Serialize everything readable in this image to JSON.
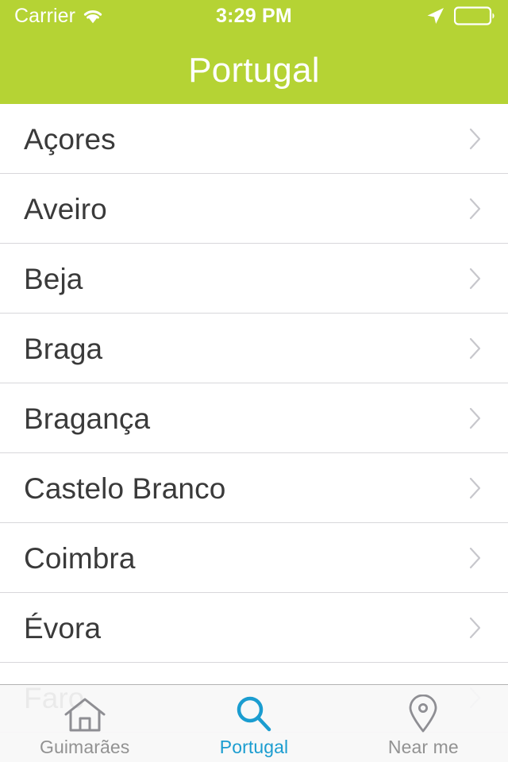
{
  "status_bar": {
    "carrier": "Carrier",
    "wifi_icon": "wifi-icon",
    "time": "3:29 PM",
    "location_icon": "location-arrow-icon",
    "battery_icon": "battery-icon"
  },
  "nav": {
    "title": "Portugal",
    "background_color": "#b5d334",
    "title_color": "#ffffff"
  },
  "list": {
    "rows": [
      {
        "label": "Açores",
        "accessory": "chevron-right-icon"
      },
      {
        "label": "Aveiro",
        "accessory": "chevron-right-icon"
      },
      {
        "label": "Beja",
        "accessory": "chevron-right-icon"
      },
      {
        "label": "Braga",
        "accessory": "chevron-right-icon"
      },
      {
        "label": "Bragança",
        "accessory": "chevron-right-icon"
      },
      {
        "label": "Castelo Branco",
        "accessory": "chevron-right-icon"
      },
      {
        "label": "Coimbra",
        "accessory": "chevron-right-icon"
      },
      {
        "label": "Évora",
        "accessory": "chevron-right-icon"
      },
      {
        "label": "Faro",
        "accessory": "chevron-right-icon"
      }
    ]
  },
  "tab_bar": {
    "active_color": "#1b9dd0",
    "inactive_color": "#929292",
    "tabs": [
      {
        "label": "Guimarães",
        "icon": "home-icon",
        "active": false
      },
      {
        "label": "Portugal",
        "icon": "search-icon",
        "active": true
      },
      {
        "label": "Near me",
        "icon": "map-pin-icon",
        "active": false
      }
    ]
  }
}
